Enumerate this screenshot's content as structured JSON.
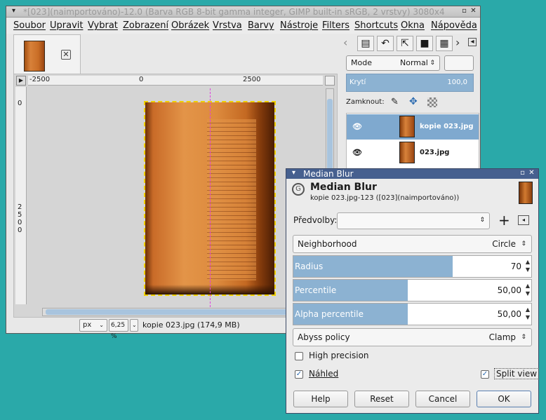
{
  "main_window": {
    "title": "*[023](naimportováno)-12.0 (Barva RGB 8-bit gamma integer, GIMP built-in sRGB, 2 vrstvy) 3080x4",
    "menu": [
      "Soubor",
      "Upravit",
      "Vybrat",
      "Zobrazení",
      "Obrázek",
      "Vrstva",
      "Barvy",
      "Nástroje",
      "Filters",
      "Shortcuts",
      "Okna",
      "Nápověda"
    ],
    "ruler_h": [
      "-2500",
      "0",
      "2500"
    ],
    "ruler_v": [
      "0",
      "2",
      "5",
      "0",
      "0"
    ],
    "status": {
      "unit": "px",
      "zoom": "6,25 %",
      "info": "kopie 023.jpg (174,9 MB)"
    }
  },
  "layers_panel": {
    "mode_label": "Mode",
    "mode_value": "Normal",
    "opacity_label": "Krytí",
    "opacity_value": "100,0",
    "lock_label": "Zamknout:",
    "layers": [
      {
        "name": "kopie 023.jpg",
        "selected": true
      },
      {
        "name": "023.jpg",
        "selected": false
      }
    ]
  },
  "median_blur": {
    "window_title": "Median Blur",
    "header_title": "Median Blur",
    "header_subtitle": "kopie 023.jpg-123 ([023](naimportováno))",
    "presets_label": "Předvolby:",
    "neighborhood": {
      "label": "Neighborhood",
      "value": "Circle"
    },
    "radius": {
      "label": "Radius",
      "value": "70",
      "fill_fraction": 0.67
    },
    "percentile": {
      "label": "Percentile",
      "value": "50,00",
      "fill_fraction": 0.48
    },
    "alpha_percentile": {
      "label": "Alpha percentile",
      "value": "50,00",
      "fill_fraction": 0.48
    },
    "abyss_policy": {
      "label": "Abyss policy",
      "value": "Clamp"
    },
    "high_precision": {
      "label": "High precision",
      "checked": false
    },
    "preview": {
      "label": "Náhled",
      "checked": true
    },
    "split_view": {
      "label": "Split view",
      "checked": true
    },
    "buttons": {
      "help": "Help",
      "reset": "Reset",
      "cancel": "Cancel",
      "ok": "OK"
    }
  },
  "colors": {
    "desktop": "#2aa9a9",
    "accent": "#8cb2d2",
    "dialog_title": "#46608f"
  }
}
